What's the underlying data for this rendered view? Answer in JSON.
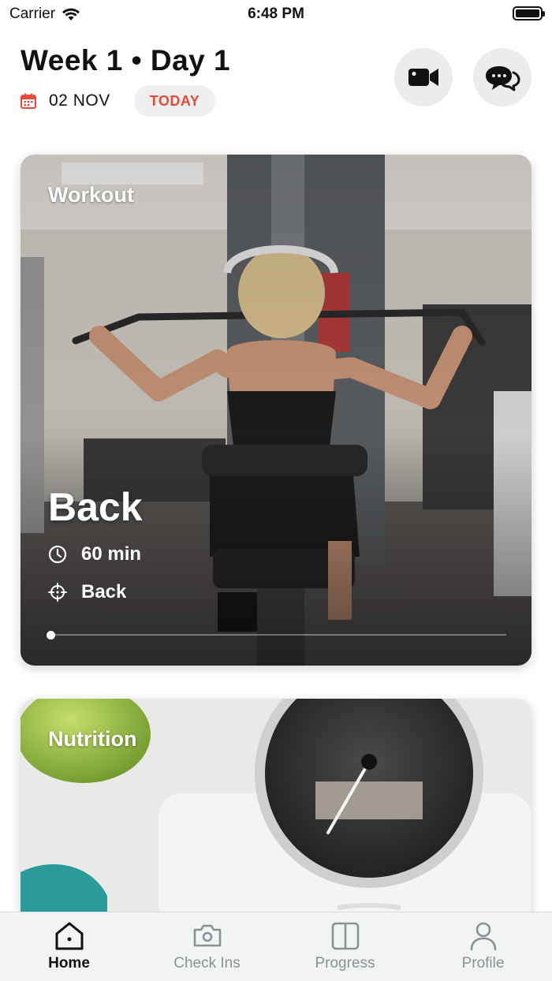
{
  "status_bar": {
    "carrier": "Carrier",
    "time": "6:48 PM"
  },
  "header": {
    "title": "Week 1 • Day 1",
    "date": "02 NOV",
    "today_label": "TODAY"
  },
  "workout_card": {
    "label": "Workout",
    "name": "Back",
    "duration": "60 min",
    "target": "Back",
    "progress": 0
  },
  "nutrition_card": {
    "label": "Nutrition"
  },
  "tabs": [
    {
      "label": "Home",
      "icon": "home-icon",
      "active": true
    },
    {
      "label": "Check Ins",
      "icon": "camera-icon",
      "active": false
    },
    {
      "label": "Progress",
      "icon": "progress-icon",
      "active": false
    },
    {
      "label": "Profile",
      "icon": "profile-icon",
      "active": false
    }
  ],
  "colors": {
    "accent": "#e64a3b",
    "tab_inactive": "#8a9296"
  }
}
